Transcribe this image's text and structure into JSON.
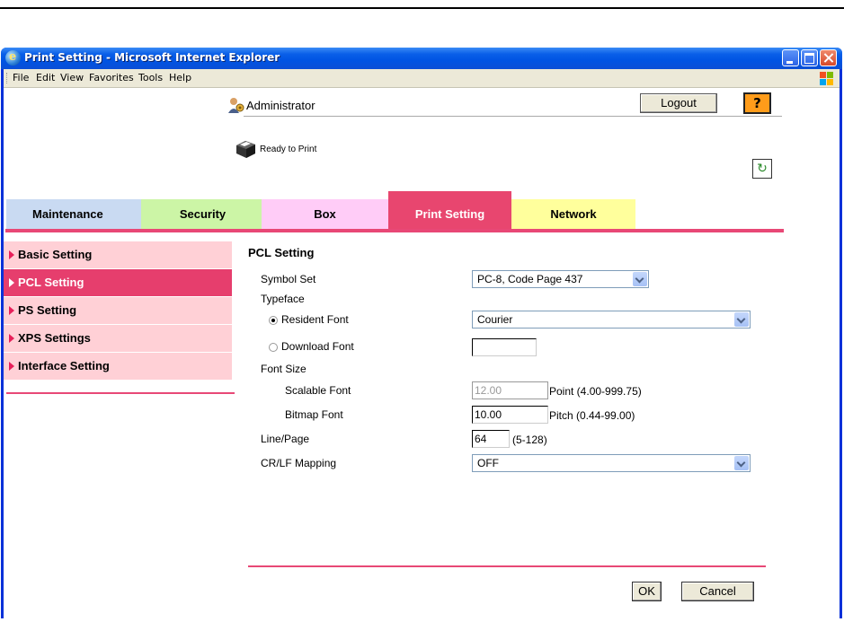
{
  "window": {
    "title": "Print Setting - Microsoft Internet Explorer"
  },
  "menubar": {
    "items": [
      "File",
      "Edit",
      "View",
      "Favorites",
      "Tools",
      "Help"
    ]
  },
  "header": {
    "user": "Administrator",
    "logout_label": "Logout",
    "help_label": "?",
    "status": "Ready to Print",
    "refresh_icon": "refresh-icon"
  },
  "tabs": [
    {
      "label": "Maintenance",
      "color": "#c9daf2"
    },
    {
      "label": "Security",
      "color": "#ccf5a6"
    },
    {
      "label": "Box",
      "color": "#ffccf7"
    },
    {
      "label": "Print Setting",
      "color": "#e8466f",
      "active": true
    },
    {
      "label": "Network",
      "color": "#ffff9c"
    }
  ],
  "sidebar": {
    "items": [
      {
        "label": "Basic Setting"
      },
      {
        "label": "PCL Setting",
        "active": true
      },
      {
        "label": "PS Setting"
      },
      {
        "label": "XPS Settings"
      },
      {
        "label": "Interface Setting"
      }
    ]
  },
  "form": {
    "heading": "PCL Setting",
    "symbol_set_label": "Symbol Set",
    "symbol_set_value": "PC-8, Code Page 437",
    "typeface_label": "Typeface",
    "resident_font_label": "Resident Font",
    "resident_font_value": "Courier",
    "resident_font_checked": true,
    "download_font_label": "Download Font",
    "download_font_value": "",
    "font_size_label": "Font Size",
    "scalable_font_label": "Scalable Font",
    "scalable_font_value": "12.00",
    "scalable_font_range": "Point (4.00-999.75)",
    "bitmap_font_label": "Bitmap Font",
    "bitmap_font_value": "10.00",
    "bitmap_font_range": "Pitch (0.44-99.00)",
    "line_page_label": "Line/Page",
    "line_page_value": "64",
    "line_page_range": "(5-128)",
    "crlf_label": "CR/LF Mapping",
    "crlf_value": "OFF",
    "ok_label": "OK",
    "cancel_label": "Cancel"
  },
  "colors": {
    "accent": "#e84876",
    "sidebar_active": "#e63e6d",
    "sidebar_item": "#ffd0d6"
  }
}
